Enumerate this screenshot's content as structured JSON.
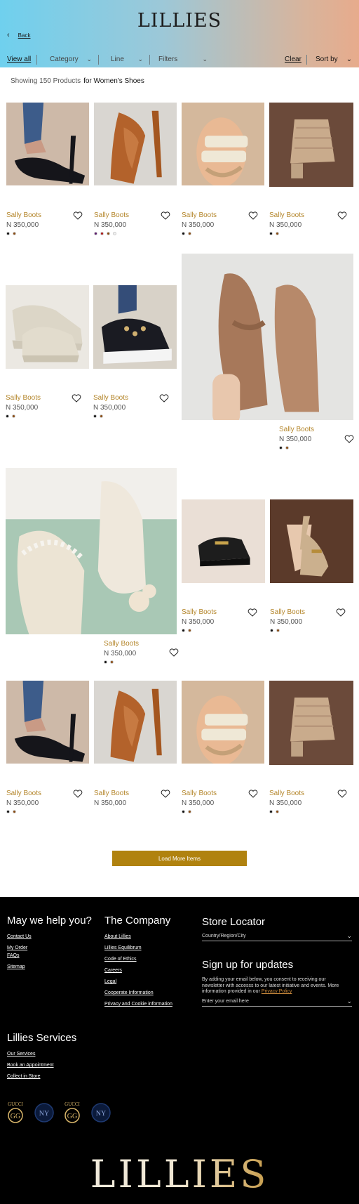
{
  "header": {
    "logo": "LILLIES",
    "back_label": "Back"
  },
  "filters": {
    "view_all": "View all",
    "category": "Category",
    "line": "Line",
    "filters": "Filters",
    "clear": "Clear",
    "sort_by": "Sort by"
  },
  "results": {
    "showing": "Showing 150 Products",
    "for": "for Women's Shoes"
  },
  "products": [
    {
      "title": "Sally Boots",
      "price": "N 350,000",
      "image": "black-strappy-heel",
      "swatches": [
        "#111111",
        "#8a4b12"
      ]
    },
    {
      "title": "Sally Boots",
      "price": "N 350,000",
      "image": "tan-pointed-pump",
      "swatches": [
        "#5b1a6e",
        "#b01818",
        "#8a4b12",
        "#f2f2f2"
      ]
    },
    {
      "title": "Sally Boots",
      "price": "N 350,000",
      "image": "cream-strap-sandal",
      "swatches": [
        "#111111",
        "#8a4b12"
      ]
    },
    {
      "title": "Sally Boots",
      "price": "N 350,000",
      "image": "beige-knit-mule",
      "swatches": [
        "#111111",
        "#8a4b12"
      ]
    },
    {
      "title": "Sally Boots",
      "price": "N 350,000",
      "image": "white-chunky-sneaker",
      "swatches": [
        "#111111",
        "#8a4b12"
      ]
    },
    {
      "title": "Sally Boots",
      "price": "N 350,000",
      "image": "black-studded-sneaker",
      "swatches": [
        "#111111",
        "#8a4b12"
      ]
    },
    {
      "title": "Sally Boots",
      "price": "N 350,000",
      "image": "tan-pointed-flat",
      "swatches": [
        "#111111",
        "#8a4b12"
      ]
    },
    {
      "title": "Sally Boots",
      "price": "N 350,000",
      "image": "cream-pearl-mule",
      "swatches": [
        "#111111",
        "#8a4b12"
      ]
    },
    {
      "title": "Sally Boots",
      "price": "N 350,000",
      "image": "black-loafer",
      "swatches": [
        "#111111",
        "#8a4b12"
      ]
    },
    {
      "title": "Sally Boots",
      "price": "N 350,000",
      "image": "beige-slingback",
      "swatches": [
        "#111111",
        "#8a4b12"
      ]
    },
    {
      "title": "Sally Boots",
      "price": "N 350,000",
      "image": "black-strappy-heel",
      "swatches": [
        "#111111",
        "#8a4b12"
      ]
    },
    {
      "title": "Sally Boots",
      "price": "N 350,000",
      "image": "tan-pointed-pump",
      "swatches": []
    },
    {
      "title": "Sally Boots",
      "price": "N 350,000",
      "image": "cream-strap-sandal",
      "swatches": [
        "#111111",
        "#8a4b12"
      ]
    },
    {
      "title": "Sally Boots",
      "price": "N 350,000",
      "image": "beige-knit-mule",
      "swatches": [
        "#111111",
        "#8a4b12"
      ]
    }
  ],
  "load_more": "Load More Items",
  "footer": {
    "help": {
      "heading": "May we help you?",
      "links": [
        "Contact Us",
        "My Order",
        "FAQs",
        "Sitemap"
      ]
    },
    "company": {
      "heading": "The Company",
      "links": [
        "About Lillies",
        "Lillies Equilibrum",
        "Code of Ethics",
        "Careers",
        "Legal",
        "Cooperate Information",
        "Privacy and Cookie information"
      ]
    },
    "store_locator": {
      "heading": "Store Locator",
      "select": "Country/Region/City"
    },
    "signup": {
      "heading": "Sign up for updates",
      "text": "By adding your email below, you consent to receiving our newsletter with accesss to our latest initiative and events. More information provided in our",
      "privacy_link": "Privacy Policy",
      "email_placeholder": "Enter your email here"
    },
    "services": {
      "heading": "Lillies Services",
      "links": [
        "Our Services",
        "Book an Appointment",
        "Collect in Store"
      ]
    },
    "badges": [
      "GUCCI",
      "",
      "GUCCI",
      ""
    ],
    "brand": "LILLIES"
  },
  "colors": {
    "accent_gold": "#b0820f",
    "title_gold": "#b4862b"
  }
}
